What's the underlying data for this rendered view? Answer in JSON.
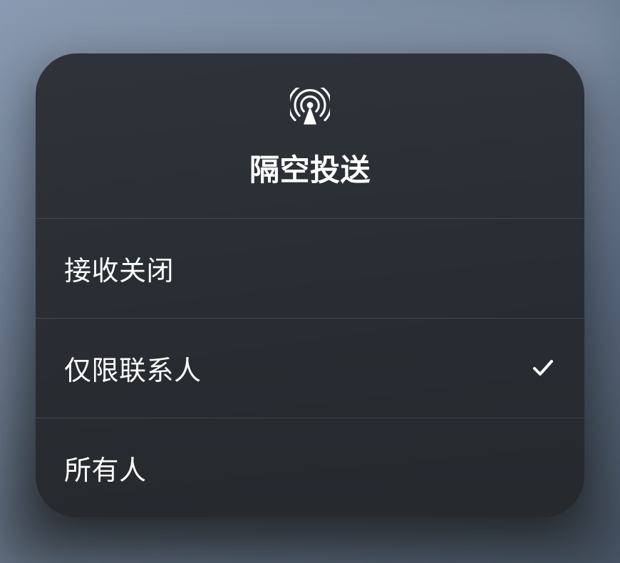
{
  "header": {
    "title": "隔空投送"
  },
  "options": [
    {
      "label": "接收关闭",
      "selected": false
    },
    {
      "label": "仅限联系人",
      "selected": true
    },
    {
      "label": "所有人",
      "selected": false
    }
  ]
}
